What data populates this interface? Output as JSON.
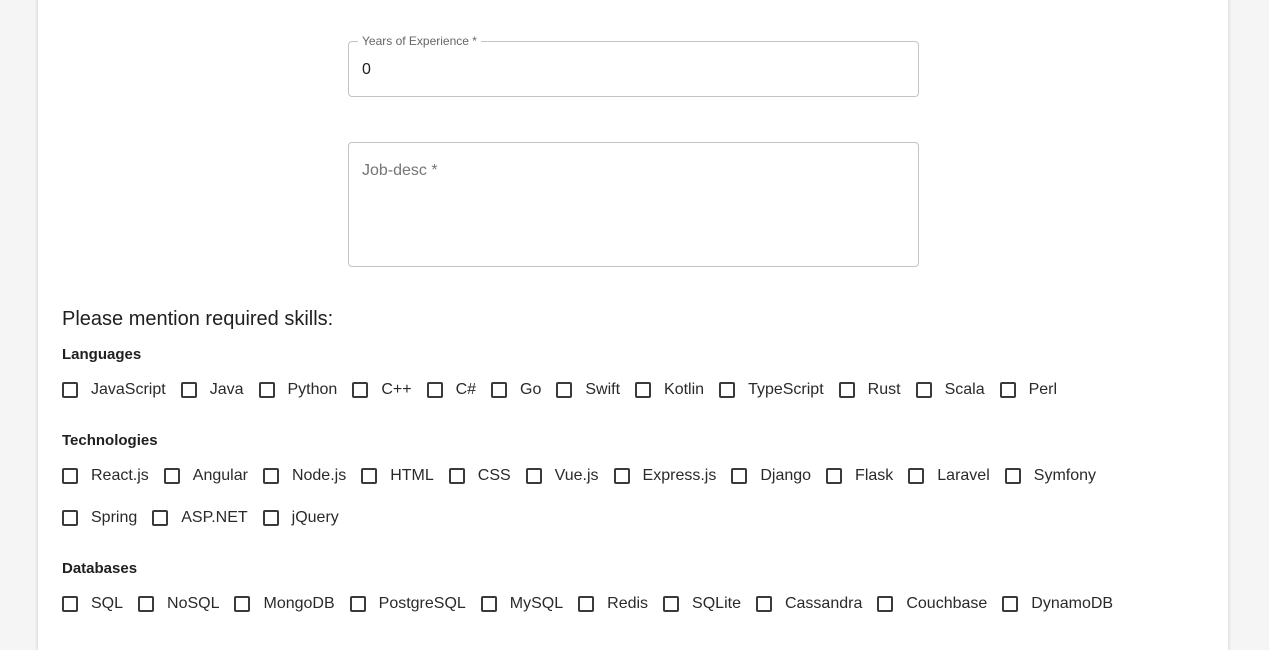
{
  "form": {
    "experience": {
      "label": "Years of Experience *",
      "value": "0"
    },
    "job_desc": {
      "placeholder": "Job-desc *"
    }
  },
  "skills": {
    "heading": "Please mention required skills:",
    "groups": [
      {
        "title": "Languages",
        "rows": [
          [
            "JavaScript",
            "Java",
            "Python",
            "C++",
            "C#",
            "Go",
            "Swift",
            "Kotlin",
            "TypeScript",
            "Rust",
            "Scala",
            "Perl"
          ]
        ]
      },
      {
        "title": "Technologies",
        "rows": [
          [
            "React.js",
            "Angular",
            "Node.js",
            "HTML",
            "CSS",
            "Vue.js",
            "Express.js",
            "Django",
            "Flask",
            "Laravel",
            "Symfony"
          ],
          [
            "Spring",
            "ASP.NET",
            "jQuery"
          ]
        ]
      },
      {
        "title": "Databases",
        "rows": [
          [
            "SQL",
            "NoSQL",
            "MongoDB",
            "PostgreSQL",
            "MySQL",
            "Redis",
            "SQLite",
            "Cassandra",
            "Couchbase",
            "DynamoDB"
          ]
        ]
      }
    ]
  }
}
